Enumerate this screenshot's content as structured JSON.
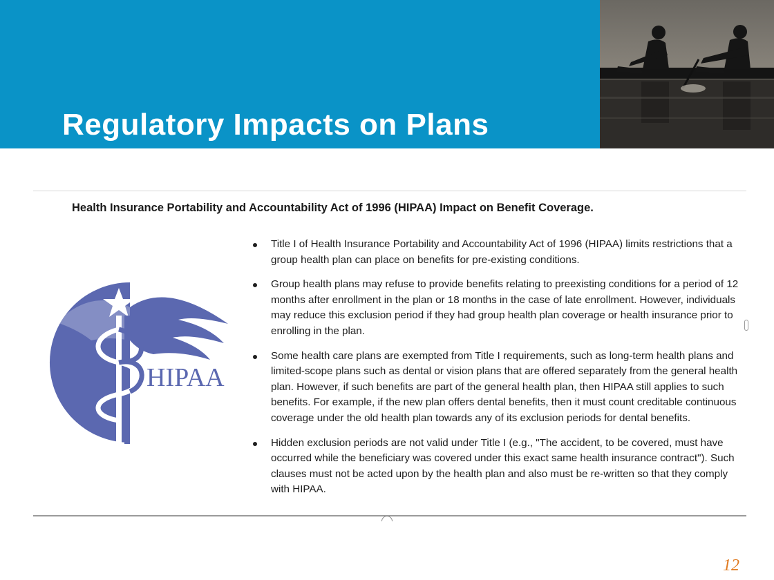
{
  "slide": {
    "title": "Regulatory Impacts on Plans",
    "page_number": "12",
    "accent_color": "#0a93c7",
    "page_number_color": "#e07b22"
  },
  "photo": {
    "icon": "rowers-photo"
  },
  "embedded_document": {
    "heading": "Health Insurance Portability and Accountability Act of 1996 (HIPAA) Impact on Benefit Coverage.",
    "logo": {
      "icon": "caduceus-logo",
      "text": "HIPAA",
      "color": "#5b68b0"
    },
    "bullets": [
      "Title I of Health Insurance Portability and Accountability Act of 1996 (HIPAA) limits restrictions that a group health plan can place on benefits for pre-existing conditions.",
      "Group health plans may refuse to provide benefits relating to preexisting conditions for a period of 12 months after enrollment in the plan or 18 months in the case of late enrollment. However, individuals may reduce this exclusion period if they had group health plan coverage or health insurance prior to enrolling in the plan.",
      "Some health care plans are exempted from Title I requirements, such as long-term health plans and limited-scope plans such as dental or vision plans that are offered separately from the general health plan. However, if such benefits are part of the general health plan, then HIPAA still applies to such benefits. For example, if the new plan offers dental benefits, then it must count creditable continuous coverage under the old health plan towards any of its exclusion periods for dental benefits.",
      "Hidden exclusion periods are not valid under Title I (e.g., \"The accident, to be covered, must have occurred while the beneficiary was covered under this exact same health insurance contract\"). Such clauses must not be acted upon by the health plan and also must be re-written so that they comply with HIPAA."
    ]
  }
}
